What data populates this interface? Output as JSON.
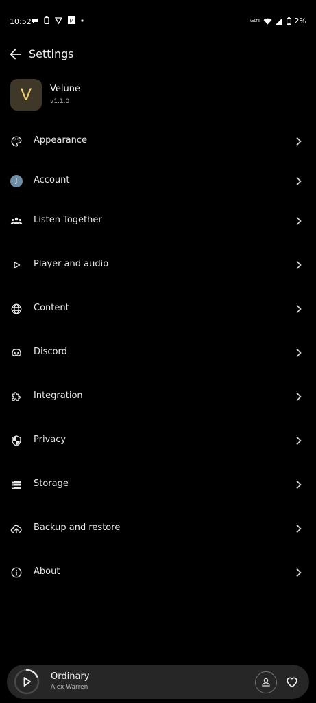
{
  "status_bar": {
    "time": "10:52",
    "battery": "2%",
    "network": "VoLTE"
  },
  "header": {
    "title": "Settings"
  },
  "app": {
    "logo_letter": "V",
    "name": "Velune",
    "version": "v1.1.0"
  },
  "menu": {
    "items": [
      {
        "label": "Appearance",
        "icon": "palette-icon"
      },
      {
        "label": "Account",
        "icon": "avatar-icon",
        "avatar_letter": "J"
      },
      {
        "label": "Listen Together",
        "icon": "group-icon"
      },
      {
        "label": "Player and audio",
        "icon": "play-icon"
      },
      {
        "label": "Content",
        "icon": "globe-icon"
      },
      {
        "label": "Discord",
        "icon": "discord-icon"
      },
      {
        "label": "Integration",
        "icon": "puzzle-icon"
      },
      {
        "label": "Privacy",
        "icon": "shield-icon"
      },
      {
        "label": "Storage",
        "icon": "storage-icon"
      },
      {
        "label": "Backup and restore",
        "icon": "cloud-sync-icon"
      },
      {
        "label": "About",
        "icon": "info-icon"
      }
    ]
  },
  "player": {
    "song": "Ordinary",
    "artist": "Alex Warren",
    "progress": 0.18
  }
}
